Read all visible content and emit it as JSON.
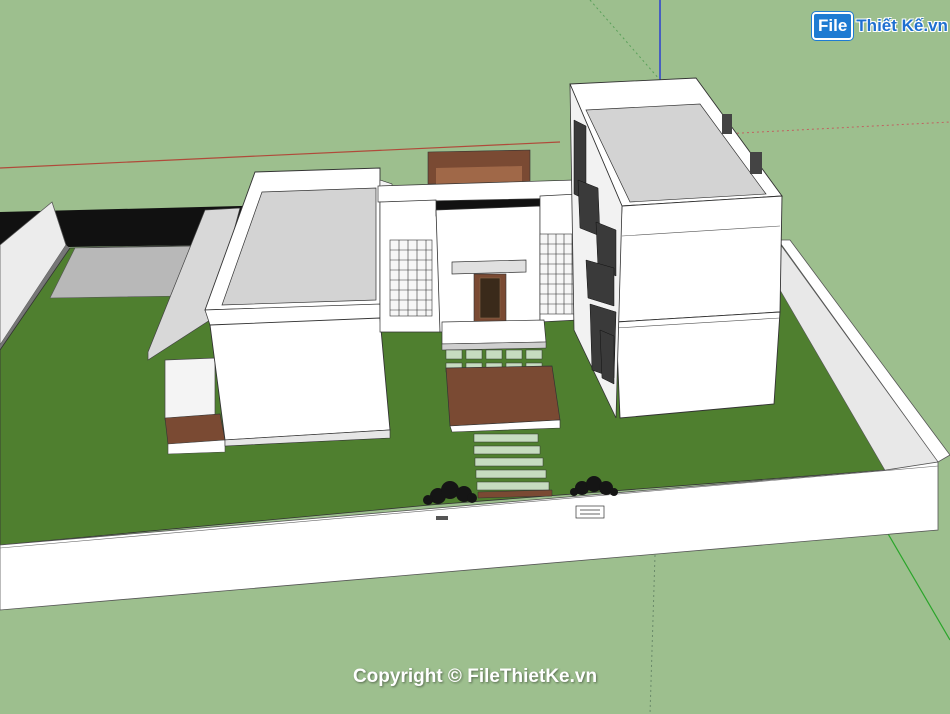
{
  "watermark": {
    "logo_box_text": "File",
    "logo_rest_text": "Thiết Kế.vn"
  },
  "copyright_text": "Copyright © FileThietKe.vn",
  "colors": {
    "ground": "#9dbf8e",
    "lawn": "#4f7f2f",
    "wall": "#ffffff",
    "roof": "#d3d3d3",
    "wood": "#7a4a33",
    "axis_red": "#c04040",
    "axis_green": "#2aa52a",
    "axis_blue": "#2040d0"
  }
}
